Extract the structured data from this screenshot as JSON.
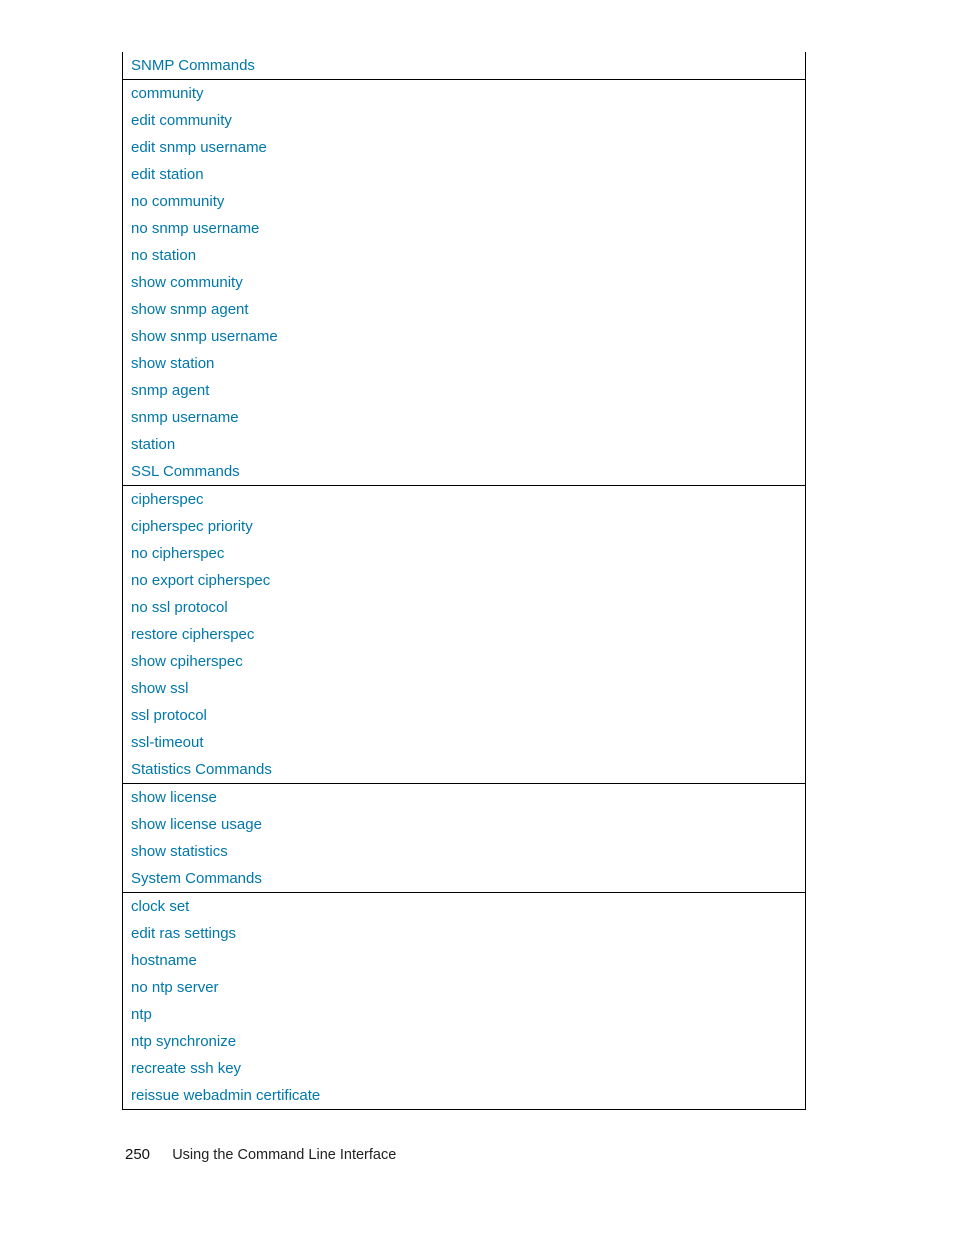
{
  "sections": [
    {
      "title": "SNMP Commands",
      "items": [
        "community",
        "edit community",
        "edit snmp username",
        "edit station",
        "no community",
        "no snmp username",
        "no station",
        "show community",
        "show snmp agent",
        "show snmp username",
        "show station",
        "snmp agent",
        "snmp username",
        "station"
      ]
    },
    {
      "title": "SSL Commands",
      "items": [
        "cipherspec",
        "cipherspec priority",
        "no cipherspec",
        "no export cipherspec",
        "no ssl protocol",
        "restore cipherspec",
        "show cpiherspec",
        "show ssl",
        "ssl protocol",
        "ssl-timeout"
      ]
    },
    {
      "title": "Statistics Commands",
      "items": [
        "show license",
        "show license usage",
        "show statistics"
      ]
    },
    {
      "title": "System Commands",
      "items": [
        "clock set",
        "edit ras settings",
        "hostname",
        "no ntp server",
        "ntp",
        "ntp synchronize",
        "recreate ssh key",
        "reissue webadmin certificate"
      ]
    }
  ],
  "footer": {
    "page_number": "250",
    "chapter": "Using the Command Line Interface"
  }
}
